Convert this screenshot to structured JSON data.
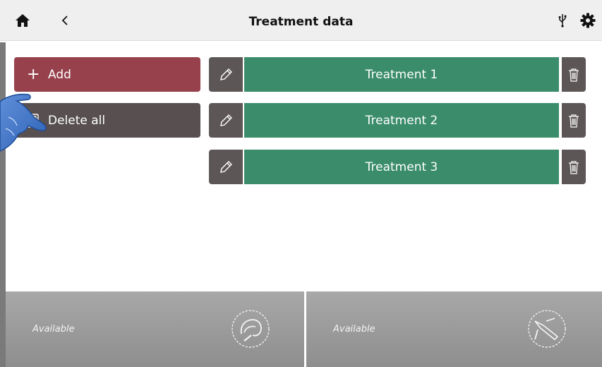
{
  "header": {
    "title": "Treatment data",
    "home_icon": "home-icon",
    "back_icon": "chevron-left-icon",
    "usb_icon": "usb-icon",
    "settings_icon": "gear-icon"
  },
  "actions": {
    "add_label": "Add",
    "add_icon": "plus-icon",
    "delete_all_label": "Delete all",
    "delete_all_icon": "delete-all-icon"
  },
  "treatments": [
    {
      "label": "Treatment 1"
    },
    {
      "label": "Treatment 2"
    },
    {
      "label": "Treatment 3"
    }
  ],
  "panels": [
    {
      "status": "Available",
      "device_icon": "handpiece-icon"
    },
    {
      "status": "Available",
      "device_icon": "applicator-icon"
    }
  ],
  "colors": {
    "add": "#96414c",
    "delete_all": "#585050",
    "treatment": "#3a8c6b",
    "row_icon_bg": "#5d5656",
    "panel": "#9a9a9a",
    "header_bg": "#efefef"
  }
}
